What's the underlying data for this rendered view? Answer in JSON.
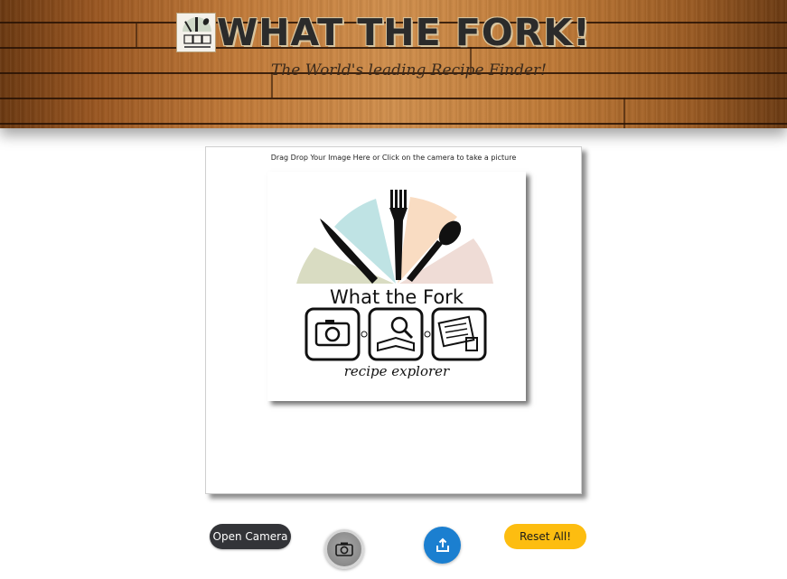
{
  "header": {
    "title": "WHAT THE FORK!",
    "tagline": "The World's leading Recipe Finder!",
    "logo_icon": "what-the-fork-logo"
  },
  "dropzone": {
    "hint": "Drag Drop Your Image Here or Click on the camera to take a picture",
    "preview": {
      "brand_name": "What the Fork",
      "brand_subtitle": "recipe explorer",
      "step_icons": [
        "camera-icon",
        "book-search-icon",
        "recipe-card-icon"
      ],
      "fan_colors": [
        "#d9dcc2",
        "#bfe3e4",
        "#f9dcc2",
        "#efdcd6"
      ]
    }
  },
  "controls": {
    "open_camera_label": "Open Camera",
    "capture_icon": "camera-icon",
    "share_icon": "share-icon",
    "reset_label": "Reset All!",
    "colors": {
      "open_camera_bg": "#333438",
      "share_bg": "#1b7fd0",
      "reset_bg": "#fdbd10"
    }
  }
}
